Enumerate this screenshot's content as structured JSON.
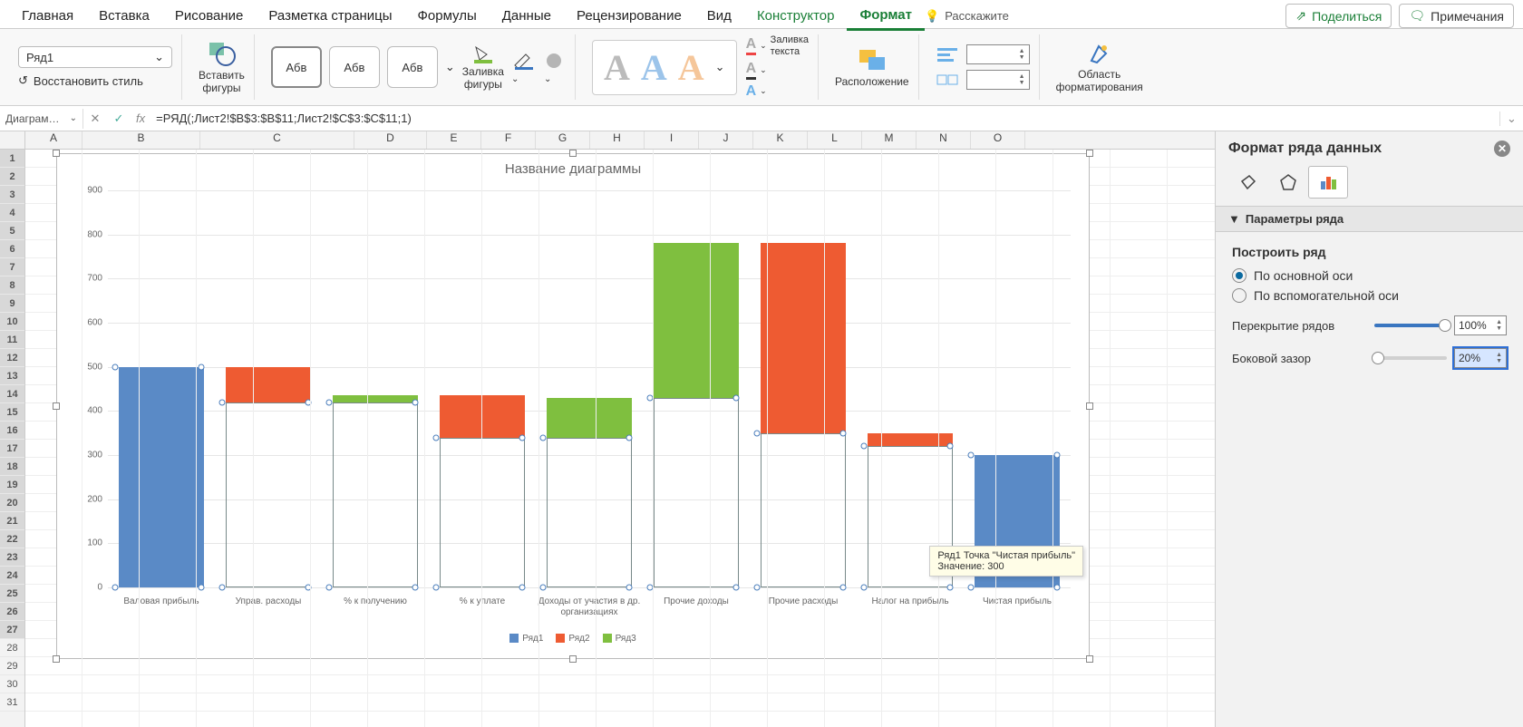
{
  "ribbon": {
    "tabs": [
      "Главная",
      "Вставка",
      "Рисование",
      "Разметка страницы",
      "Формулы",
      "Данные",
      "Рецензирование",
      "Вид",
      "Конструктор",
      "Формат"
    ],
    "active_tab": "Формат",
    "tell_me": "Расскажите",
    "share": "Поделиться",
    "comments": "Примечания"
  },
  "toolbar": {
    "selector_value": "Ряд1",
    "restore_style": "Восстановить стиль",
    "insert_shapes": "Вставить\nфигуры",
    "shape_sample": "Абв",
    "shape_fill": "Заливка\nфигуры",
    "text_fill": "Заливка\nтекста",
    "arrange": "Расположение",
    "format_pane": "Область\nформатирования"
  },
  "formula_bar": {
    "name_box": "Диаграм…",
    "fx": "fx",
    "formula": "=РЯД(;Лист2!$B$3:$B$11;Лист2!$C$3:$C$11;1)"
  },
  "sheet": {
    "columns": [
      "A",
      "B",
      "C",
      "D",
      "E",
      "F",
      "G",
      "H",
      "I",
      "J",
      "K",
      "L",
      "M",
      "N",
      "O"
    ],
    "rows": 31
  },
  "chart_data": {
    "type": "bar",
    "title": "Название диаграммы",
    "ylim": [
      0,
      900
    ],
    "yticks": [
      0,
      100,
      200,
      300,
      400,
      500,
      600,
      700,
      800,
      900
    ],
    "categories": [
      "Валовая прибыль",
      "Управ. расходы",
      "% к получению",
      "% к уплате",
      "Доходы от участия в др. организациях",
      "Прочие доходы",
      "Прочие расходы",
      "Налог на прибыль",
      "Чистая прибыль"
    ],
    "series": [
      {
        "name": "Ряд1",
        "color": "#5a8ac6"
      },
      {
        "name": "Ряд2",
        "color": "#ee5b32"
      },
      {
        "name": "Ряд3",
        "color": "#7fbf3f"
      }
    ],
    "bars": [
      {
        "base": 0,
        "top": 500,
        "color": "blue",
        "outline": false
      },
      {
        "base": 420,
        "top": 500,
        "color": "orange",
        "outline": true,
        "outline_base": 0,
        "outline_top": 420
      },
      {
        "base": 420,
        "top": 435,
        "color": "green",
        "outline": true,
        "outline_base": 0,
        "outline_top": 420
      },
      {
        "base": 340,
        "top": 435,
        "color": "orange",
        "outline": true,
        "outline_base": 0,
        "outline_top": 340
      },
      {
        "base": 340,
        "top": 430,
        "color": "green",
        "outline": true,
        "outline_base": 0,
        "outline_top": 340
      },
      {
        "base": 430,
        "top": 780,
        "color": "green",
        "outline": true,
        "outline_base": 0,
        "outline_top": 430
      },
      {
        "base": 350,
        "top": 780,
        "color": "orange",
        "outline": true,
        "outline_base": 0,
        "outline_top": 350
      },
      {
        "base": 320,
        "top": 350,
        "color": "orange",
        "outline": true,
        "outline_base": 0,
        "outline_top": 320
      },
      {
        "base": 0,
        "top": 300,
        "color": "blue",
        "outline": false
      }
    ],
    "tooltip": {
      "line1": "Ряд1 Точка \"Чистая прибыль\"",
      "line2": "Значение: 300"
    }
  },
  "format_pane": {
    "title": "Формат ряда данных",
    "section_title": "Параметры ряда",
    "build_row_label": "Построить ряд",
    "axis_primary": "По основной оси",
    "axis_secondary": "По вспомогательной оси",
    "overlap_label": "Перекрытие рядов",
    "overlap_value": "100%",
    "gap_label": "Боковой зазор",
    "gap_value": "20%"
  }
}
